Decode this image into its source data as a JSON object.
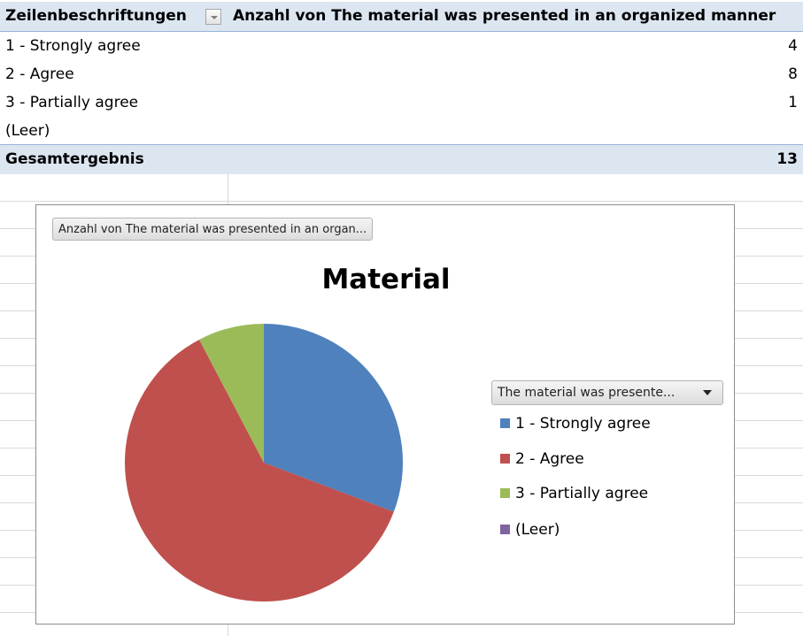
{
  "pivot": {
    "header": {
      "row_labels": "Zeilenbeschriftungen",
      "value_field": "Anzahl von The material was presented in an organized manner"
    },
    "rows": [
      {
        "label": "1 - Strongly agree",
        "value": "4"
      },
      {
        "label": "2 - Agree",
        "value": "8"
      },
      {
        "label": "3 - Partially agree",
        "value": "1"
      },
      {
        "label": "(Leer)",
        "value": ""
      }
    ],
    "total": {
      "label": "Gesamtergebnis",
      "value": "13"
    }
  },
  "chart": {
    "field_button": "Anzahl von The material was presented in an organ...",
    "legend_button": "The material was presente...",
    "title": "Material",
    "legend": [
      {
        "label": "1 - Strongly agree",
        "color": "#4f81bd"
      },
      {
        "label": "2 - Agree",
        "color": "#c0504d"
      },
      {
        "label": "3 - Partially agree",
        "color": "#9bbb59"
      },
      {
        "label": "(Leer)",
        "color": "#8064a2"
      }
    ]
  },
  "chart_data": {
    "type": "pie",
    "title": "Material",
    "categories": [
      "1 - Strongly agree",
      "2 - Agree",
      "3 - Partially agree",
      "(Leer)"
    ],
    "values": [
      4,
      8,
      1,
      0
    ],
    "colors": [
      "#4f81bd",
      "#c0504d",
      "#9bbb59",
      "#8064a2"
    ],
    "legend_position": "right"
  }
}
